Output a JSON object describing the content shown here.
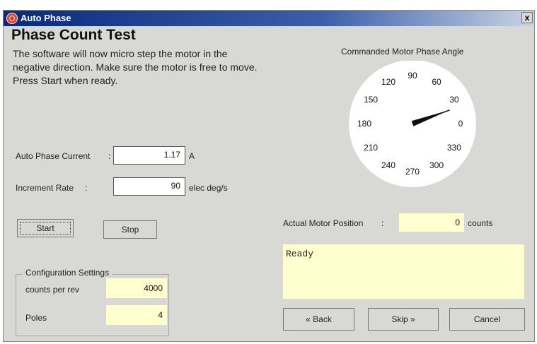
{
  "window": {
    "title": "Auto Phase",
    "close_label": "x"
  },
  "heading": "Phase Count Test",
  "instructions": "The software will now micro step the motor in the negative direction.  Make sure the motor is free to move. Press Start when ready.",
  "fields": {
    "current": {
      "label": "Auto Phase Current",
      "value": "1.17",
      "unit": "A"
    },
    "rate": {
      "label": "Increment Rate",
      "value": "90",
      "unit": "elec deg/s"
    }
  },
  "buttons": {
    "start": "Start",
    "stop": "Stop",
    "back": "« Back",
    "skip": "Skip »",
    "cancel": "Cancel"
  },
  "config": {
    "title": "Configuration Settings",
    "counts_label": "counts per rev",
    "counts_value": "4000",
    "poles_label": "Poles",
    "poles_value": "4"
  },
  "dial": {
    "title": "Commanded Motor Phase Angle",
    "angle_deg": 20,
    "labels": [
      "0",
      "30",
      "60",
      "90",
      "120",
      "150",
      "180",
      "210",
      "240",
      "270",
      "300",
      "330"
    ]
  },
  "position": {
    "label": "Actual Motor Position",
    "value": "0",
    "unit": "counts"
  },
  "status_text": "Ready"
}
